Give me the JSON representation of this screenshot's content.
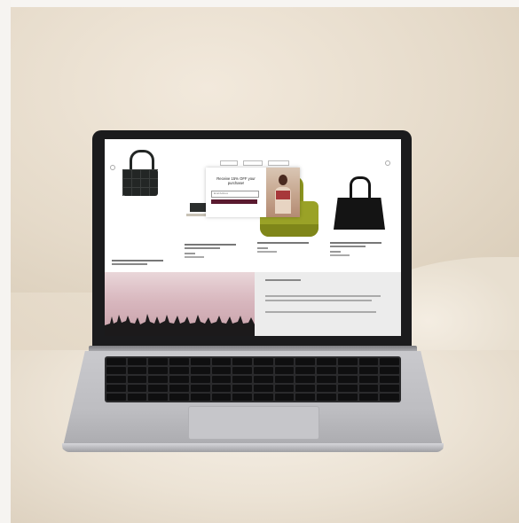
{
  "scene": {
    "description": "Silver laptop on a cream boucle sofa displaying an online handbag store",
    "colors": {
      "sofa": "#ece3d5",
      "wall": "#e5dac9",
      "laptop_aluminum": "#c9c9cd",
      "bezel": "#1b1b1d"
    }
  },
  "screen_page": {
    "popup": {
      "heading": "Receive 15% OFF your purchase!",
      "email_placeholder": "Email Address",
      "button_label": ""
    },
    "products": [
      {
        "color": "#232625",
        "name_visible": false
      },
      {
        "color": "#2b2e2d",
        "name_visible": false
      },
      {
        "color": "#9aa227",
        "name_visible": false
      },
      {
        "color": "#141414",
        "name_visible": false
      }
    ],
    "accent_color": "#5a1a2f"
  }
}
